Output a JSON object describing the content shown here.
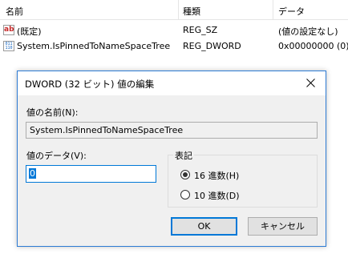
{
  "list": {
    "headers": {
      "name": "名前",
      "type": "種類",
      "data": "データ"
    },
    "rows": [
      {
        "icon": "string-value-icon",
        "icon_text": "ab",
        "name": "(既定)",
        "type": "REG_SZ",
        "data": "(値の設定なし)"
      },
      {
        "icon": "binary-value-icon",
        "icon_text": "011 110",
        "name": "System.IsPinnedToNameSpaceTree",
        "type": "REG_DWORD",
        "data": "0x00000000 (0)"
      }
    ]
  },
  "dialog": {
    "title": "DWORD (32 ビット) 値の編集",
    "close_icon": "close-icon",
    "value_name_label": "値の名前(N):",
    "value_name": "System.IsPinnedToNameSpaceTree",
    "value_data_label": "値のデータ(V):",
    "value_data": "0",
    "base_label": "表記",
    "base_options": [
      {
        "label": "16 進数(H)",
        "selected": true
      },
      {
        "label": "10 進数(D)",
        "selected": false
      }
    ],
    "ok_label": "OK",
    "cancel_label": "キャンセル"
  },
  "colors": {
    "accent": "#0078d7",
    "dialog_border": "#2d7bd4",
    "client_bg": "#f0f0f0",
    "button_bg": "#e1e1e1"
  }
}
